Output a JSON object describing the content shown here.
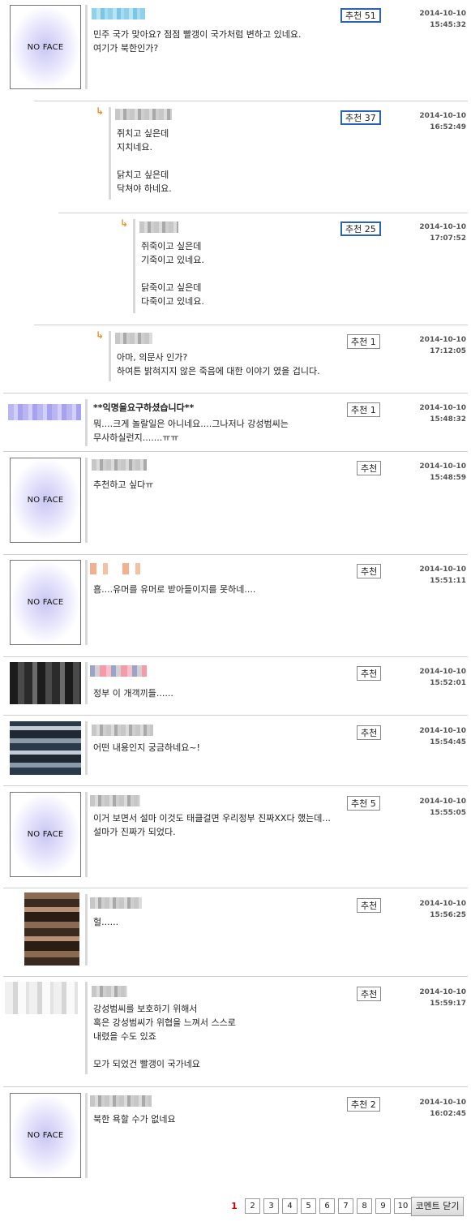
{
  "no_face_label": "NO FACE",
  "comments": [
    {
      "rec": "추천 51",
      "date": "2014-10-10",
      "time": "15:45:32",
      "text": "민주 국가 맞아요? 점점 빨갱이 국가처럼 변하고 있네요.\n여기가 북한인가?"
    },
    {
      "rec": "추천 37",
      "date": "2014-10-10",
      "time": "16:52:49",
      "text": "쥐치고 싶은데\n지치네요.\n\n닭치고 싶은데\n닥쳐야 하네요."
    },
    {
      "rec": "추천 25",
      "date": "2014-10-10",
      "time": "17:07:52",
      "text": "쥐죽이고 싶은데\n기죽이고 있네요.\n\n닭죽이고 싶은데\n다죽이고 있네요."
    },
    {
      "rec": "추천 1",
      "date": "2014-10-10",
      "time": "17:12:05",
      "text": "아마, 의문사 인가?\n하여튼 밝혀지지 않은 죽음에 대한 이야기 였을 겁니다."
    },
    {
      "rec": "추천 1",
      "date": "2014-10-10",
      "time": "15:48:32",
      "nick": "**익명을요구하셨습니다**",
      "text": "뭐....크게 놀랄일은 아니네요....그나저나 강성범씨는\n무사하실런지.......ㅠㅠ"
    },
    {
      "rec": "추천",
      "date": "2014-10-10",
      "time": "15:48:59",
      "text": "추천하고 싶다ㅠ"
    },
    {
      "rec": "추천",
      "date": "2014-10-10",
      "time": "15:51:11",
      "text": "흠....유머를 유머로 받아들이지를 못하네...."
    },
    {
      "rec": "추천",
      "date": "2014-10-10",
      "time": "15:52:01",
      "text": "정부 이 개객끼들......"
    },
    {
      "rec": "추천",
      "date": "2014-10-10",
      "time": "15:54:45",
      "text": "어떤 내용인지 궁금하네요~!"
    },
    {
      "rec": "추천 5",
      "date": "2014-10-10",
      "time": "15:55:05",
      "text": "이거 보면서 설마 이것도 태클걸면 우리정부 진짜XX다 했는데...\n설마가 진짜가 되었다."
    },
    {
      "rec": "추천",
      "date": "2014-10-10",
      "time": "15:56:25",
      "text": "헐......"
    },
    {
      "rec": "추천",
      "date": "2014-10-10",
      "time": "15:59:17",
      "text": "강성범씨를 보호하기 위해서\n혹은 강성범씨가 위협을 느껴서 스스로\n내렸을 수도 있죠\n\n모가 되었건 빨갱이 국가네요"
    },
    {
      "rec": "추천 2",
      "date": "2014-10-10",
      "time": "16:02:45",
      "text": "북한 욕할 수가 없네요"
    }
  ],
  "pagination": {
    "current": "1",
    "pages": [
      "2",
      "3",
      "4",
      "5",
      "6",
      "7",
      "8",
      "9",
      "10"
    ],
    "close_label": "코멘트 닫기"
  }
}
